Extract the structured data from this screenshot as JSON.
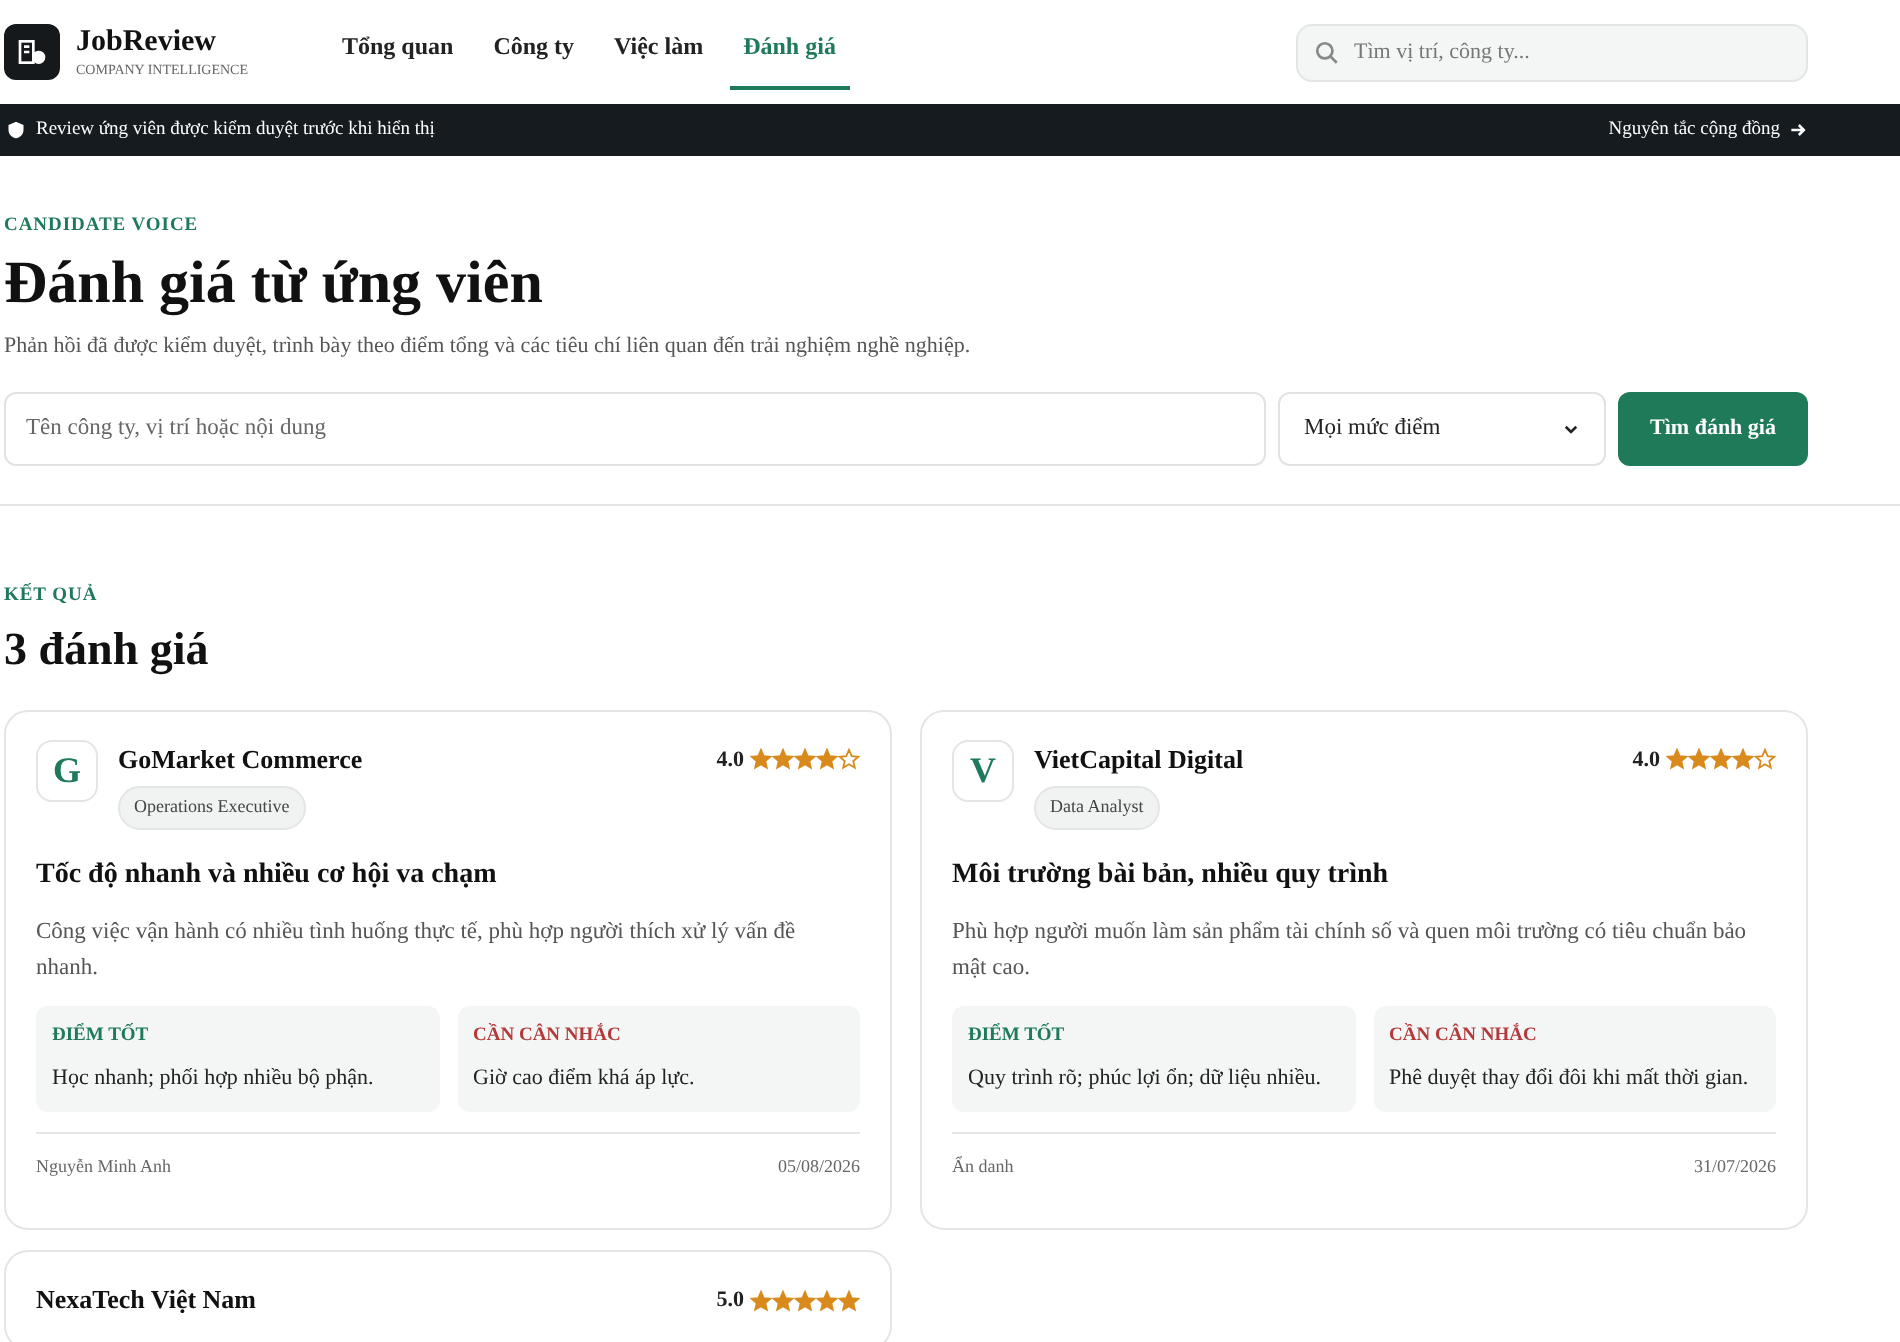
{
  "brand": {
    "name": "JobReview",
    "tagline": "COMPANY INTELLIGENCE"
  },
  "nav": [
    {
      "label": "Tổng quan",
      "selected": false
    },
    {
      "label": "Công ty",
      "selected": false
    },
    {
      "label": "Việc làm",
      "selected": false
    },
    {
      "label": "Đánh giá",
      "selected": true
    }
  ],
  "top_search": {
    "placeholder": "Tìm vị trí, công ty..."
  },
  "notice_bar": {
    "text": "Review ứng viên được kiểm duyệt trước khi hiển thị",
    "link": "Nguyên tắc cộng đồng"
  },
  "hero": {
    "eyebrow": "CANDIDATE VOICE",
    "title": "Đánh giá từ ứng viên",
    "subtitle": "Phản hồi đã được kiểm duyệt, trình bày theo điểm tổng và các tiêu chí liên quan đến trải nghiệm nghề nghiệp."
  },
  "filters": {
    "query": {
      "placeholder": "Tên công ty, vị trí hoặc nội dung"
    },
    "score": {
      "value": "Mọi mức điểm"
    },
    "submit": "Tìm đánh giá"
  },
  "results": {
    "eyebrow": "KẾT QUẢ",
    "title": "3 đánh giá"
  },
  "reviews": [
    {
      "initial": "G",
      "company": "GoMarket Commerce",
      "role": "Operations Executive",
      "score": "4.0",
      "stars": 4,
      "title": "Tốc độ nhanh và nhiều cơ hội va chạm",
      "body": "Công việc vận hành có nhiều tình huống thực tế, phù hợp người thích xử lý vấn đề nhanh.",
      "pros_label": "ĐIỂM TỐT",
      "pros": "Học nhanh; phối hợp nhiều bộ phận.",
      "cons_label": "CẦN CÂN NHẮC",
      "cons": "Giờ cao điểm khá áp lực.",
      "author": "Nguyễn Minh Anh",
      "date": "05/08/2026"
    },
    {
      "initial": "V",
      "company": "VietCapital Digital",
      "role": "Data Analyst",
      "score": "4.0",
      "stars": 4,
      "title": "Môi trường bài bản, nhiều quy trình",
      "body": "Phù hợp người muốn làm sản phẩm tài chính số và quen môi trường có tiêu chuẩn bảo mật cao.",
      "pros_label": "ĐIỂM TỐT",
      "pros": "Quy trình rõ; phúc lợi ổn; dữ liệu nhiều.",
      "cons_label": "CẦN CÂN NHẮC",
      "cons": "Phê duyệt thay đổi đôi khi mất thời gian.",
      "author": "Ẩn danh",
      "date": "31/07/2026"
    },
    {
      "company": "NexaTech Việt Nam",
      "score": "5.0",
      "stars": 5
    }
  ]
}
